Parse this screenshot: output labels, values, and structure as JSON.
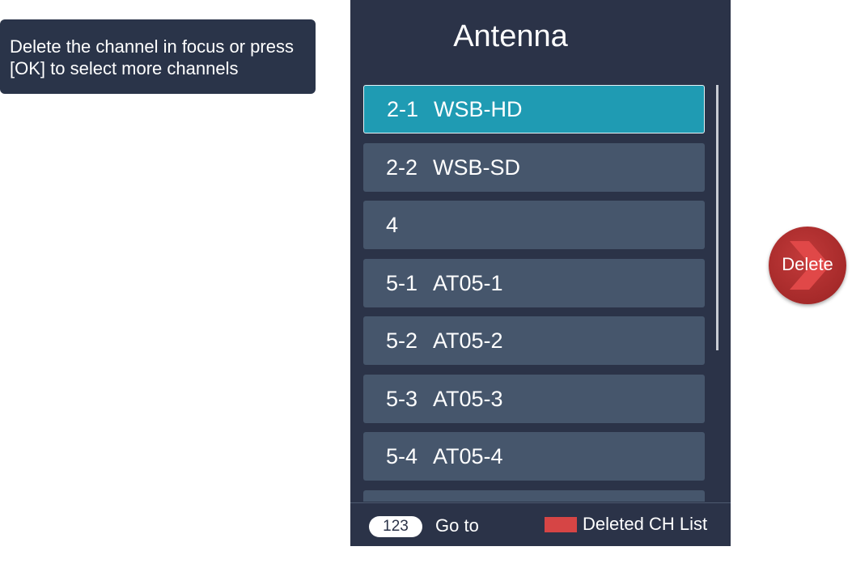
{
  "hint": {
    "line1": "Delete the channel in focus or press",
    "line2": "[OK] to select more channels"
  },
  "panel": {
    "title": "Antenna",
    "channels": [
      {
        "number": "2-1",
        "name": "WSB-HD",
        "focused": true
      },
      {
        "number": "2-2",
        "name": "WSB-SD",
        "focused": false
      },
      {
        "number": "4",
        "name": "",
        "focused": false
      },
      {
        "number": "5-1",
        "name": "AT05-1",
        "focused": false
      },
      {
        "number": "5-2",
        "name": "AT05-2",
        "focused": false
      },
      {
        "number": "5-3",
        "name": "AT05-3",
        "focused": false
      },
      {
        "number": "5-4",
        "name": "AT05-4",
        "focused": false
      }
    ]
  },
  "footer": {
    "key_label": "123",
    "goto_label": "Go to",
    "deleted_label": "Deleted CH List",
    "deleted_key_color": "#d64545"
  },
  "delete_button": {
    "label": "Delete",
    "color": "#a62a2a",
    "icon": "chevron-right-icon"
  },
  "colors": {
    "panel_bg": "#2b3348",
    "row_bg": "#46566c",
    "focus_bg": "#1f9bb3"
  }
}
